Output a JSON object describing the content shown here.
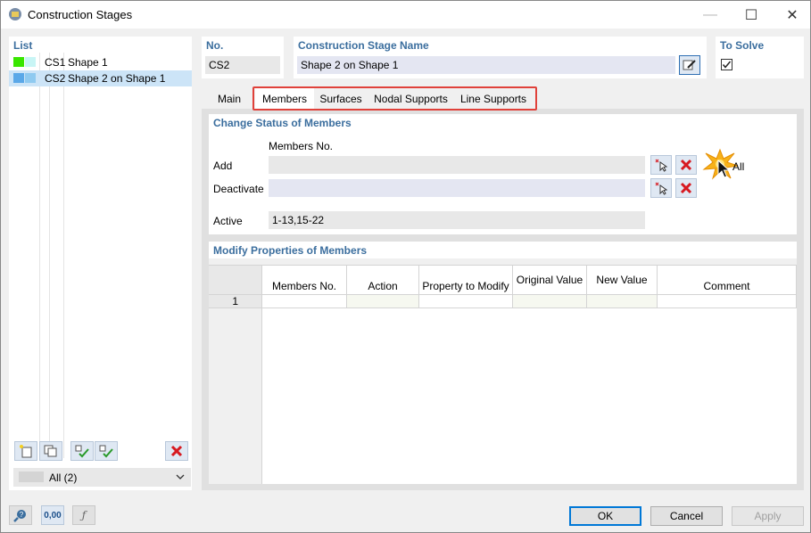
{
  "window": {
    "title": "Construction Stages",
    "minimize": "—",
    "maximize": "☐",
    "close": "✕"
  },
  "list": {
    "header": "List",
    "items": [
      {
        "id": "CS1",
        "label": "Shape 1",
        "color1": "#39e600",
        "color2": "#c8f5f5"
      },
      {
        "id": "CS2",
        "label": "Shape 2 on Shape 1",
        "color1": "#5aa8e8",
        "color2": "#8fcaf0"
      }
    ],
    "filter": {
      "label": "All (2)"
    }
  },
  "header_fields": {
    "no_label": "No.",
    "no_value": "CS2",
    "name_label": "Construction Stage Name",
    "name_value": "Shape 2 on Shape 1",
    "to_solve_label": "To Solve",
    "to_solve_checked": true
  },
  "tabs": [
    "Main",
    "Members",
    "Surfaces",
    "Nodal Supports",
    "Line Supports"
  ],
  "change_status": {
    "header": "Change Status of Members",
    "col_header": "Members No.",
    "add_label": "Add",
    "add_value": "",
    "deactivate_label": "Deactivate",
    "deactivate_value": "",
    "all_label": "All",
    "active_label": "Active",
    "active_value": "1-13,15-22"
  },
  "modify": {
    "header": "Modify Properties of Members",
    "columns": [
      "Members No.",
      "Action",
      "Property to Modify",
      "Original Value",
      "New Value",
      "Comment"
    ],
    "rows": [
      [
        "1",
        "",
        "",
        "",
        "",
        "",
        ""
      ]
    ]
  },
  "footer": {
    "ok": "OK",
    "cancel": "Cancel",
    "apply": "Apply",
    "units_icon_text": "0,00"
  }
}
